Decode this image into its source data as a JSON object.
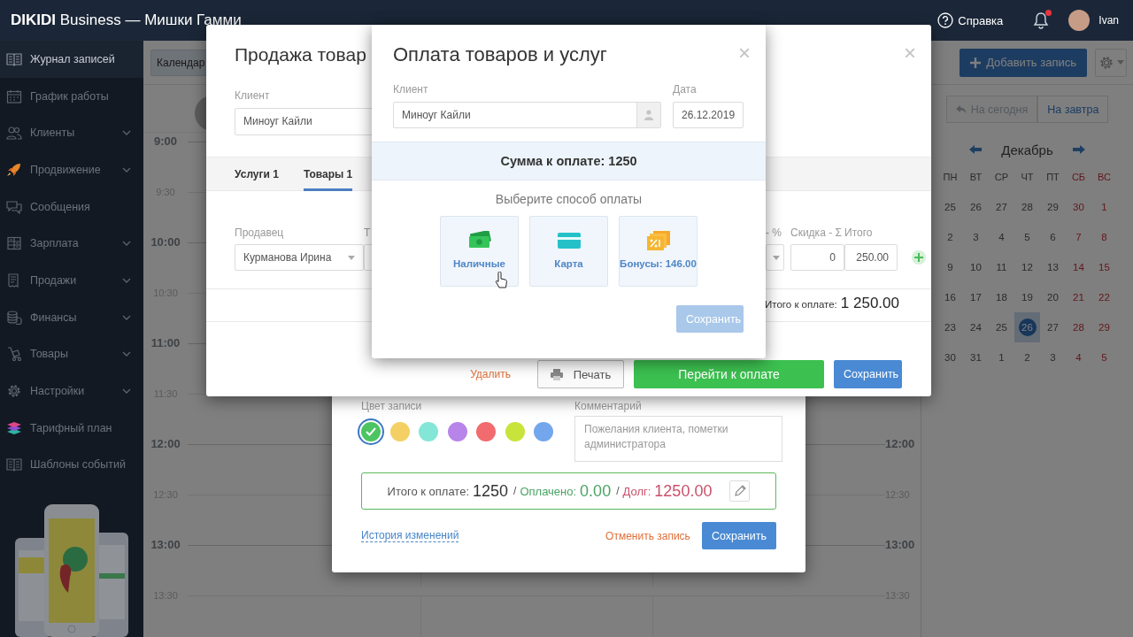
{
  "topbar": {
    "title": "**DIKIDI** Business — Мишки Гамми",
    "help": "Справка",
    "has_unread": true,
    "user": "Ivan"
  },
  "sidebar": {
    "items": [
      {
        "label": "Журнал записей",
        "selected": true,
        "expandable": false
      },
      {
        "label": "График работы",
        "selected": false,
        "expandable": false
      },
      {
        "label": "Клиенты",
        "selected": false,
        "expandable": true
      },
      {
        "label": "Продвижение",
        "selected": false,
        "expandable": true
      },
      {
        "label": "Сообщения",
        "selected": false,
        "expandable": false
      },
      {
        "label": "Зарплата",
        "selected": false,
        "expandable": true
      },
      {
        "label": "Продажи",
        "selected": false,
        "expandable": true
      },
      {
        "label": "Финансы",
        "selected": false,
        "expandable": true
      },
      {
        "label": "Товары",
        "selected": false,
        "expandable": true
      },
      {
        "label": "Настройки",
        "selected": false,
        "expandable": true
      },
      {
        "label": "Тарифный план",
        "selected": false,
        "expandable": false
      },
      {
        "label": "Шаблоны событий",
        "selected": false,
        "expandable": false
      }
    ]
  },
  "toolbar": {
    "tab": "Календар",
    "add_button": "Добавить запись"
  },
  "schedule": {
    "slots": [
      {
        "time": "9:00",
        "major": true
      },
      {
        "time": "9:30",
        "major": false
      },
      {
        "time": "10:00",
        "major": true
      },
      {
        "time": "10:30",
        "major": false
      },
      {
        "time": "11:00",
        "major": true
      },
      {
        "time": "11:30",
        "major": false
      },
      {
        "time": "12:00",
        "major": true,
        "time_right": "12:00"
      },
      {
        "time": "12:30",
        "major": false,
        "time_right": "12:30"
      },
      {
        "time": "13:00",
        "major": true,
        "time_right": "13:00"
      },
      {
        "time": "13:30",
        "major": false,
        "time_right": "13:30"
      }
    ]
  },
  "date_panel": {
    "buttons": [
      {
        "label": "На сегодня",
        "disabled": true
      },
      {
        "label": "На завтра",
        "disabled": false
      }
    ],
    "month": "Декабрь",
    "weekdays": [
      {
        "label": "ПН",
        "weekend": false
      },
      {
        "label": "ВТ",
        "weekend": false
      },
      {
        "label": "СР",
        "weekend": false
      },
      {
        "label": "ЧТ",
        "weekend": false
      },
      {
        "label": "ПТ",
        "weekend": false
      },
      {
        "label": "СБ",
        "weekend": true
      },
      {
        "label": "ВС",
        "weekend": true
      }
    ],
    "weeks": [
      [
        {
          "day": "25",
          "selected": false
        },
        {
          "day": "26",
          "selected": false
        },
        {
          "day": "27",
          "selected": false
        },
        {
          "day": "28",
          "selected": false
        },
        {
          "day": "29",
          "selected": false
        },
        {
          "day": "30",
          "selected": false
        },
        {
          "day": "1",
          "selected": false
        }
      ],
      [
        {
          "day": "2",
          "selected": false
        },
        {
          "day": "3",
          "selected": false
        },
        {
          "day": "4",
          "selected": false
        },
        {
          "day": "5",
          "selected": false
        },
        {
          "day": "6",
          "selected": false
        },
        {
          "day": "7",
          "selected": false
        },
        {
          "day": "8",
          "selected": false
        }
      ],
      [
        {
          "day": "9",
          "selected": false
        },
        {
          "day": "10",
          "selected": false
        },
        {
          "day": "11",
          "selected": false
        },
        {
          "day": "12",
          "selected": false
        },
        {
          "day": "13",
          "selected": false
        },
        {
          "day": "14",
          "selected": false
        },
        {
          "day": "15",
          "selected": false
        }
      ],
      [
        {
          "day": "16",
          "selected": false
        },
        {
          "day": "17",
          "selected": false
        },
        {
          "day": "18",
          "selected": false
        },
        {
          "day": "19",
          "selected": false
        },
        {
          "day": "20",
          "selected": false
        },
        {
          "day": "21",
          "selected": false
        },
        {
          "day": "22",
          "selected": false
        }
      ],
      [
        {
          "day": "23",
          "selected": false
        },
        {
          "day": "24",
          "selected": false
        },
        {
          "day": "25",
          "selected": false
        },
        {
          "day": "26",
          "selected": true
        },
        {
          "day": "27",
          "selected": false
        },
        {
          "day": "28",
          "selected": false
        },
        {
          "day": "29",
          "selected": false
        }
      ],
      [
        {
          "day": "30",
          "selected": false
        },
        {
          "day": "31",
          "selected": false
        },
        {
          "day": "1",
          "selected": false
        },
        {
          "day": "2",
          "selected": false
        },
        {
          "day": "3",
          "selected": false
        },
        {
          "day": "4",
          "selected": false
        },
        {
          "day": "5",
          "selected": false
        }
      ]
    ]
  },
  "appointment_dialog": {
    "color_label": "Цвет записи",
    "colors": [
      {
        "color": "#4cc462",
        "selected": true
      },
      {
        "color": "#f4cf63",
        "selected": false
      },
      {
        "color": "#84e6d6",
        "selected": false
      },
      {
        "color": "#b784ea",
        "selected": false
      },
      {
        "color": "#f26b6e",
        "selected": false
      },
      {
        "color": "#c8e43a",
        "selected": false
      },
      {
        "color": "#74a6ee",
        "selected": false
      }
    ],
    "comment_label": "Комментарий",
    "comment_placeholder": "Пожелания клиента, пометки администратора",
    "summary": [
      {
        "kind": "total",
        "label": "Итого к оплате:",
        "value": "1250"
      },
      {
        "kind": "separator",
        "text": "/"
      },
      {
        "kind": "paid",
        "label": "Оплачено:",
        "value": "0.00"
      },
      {
        "kind": "separator",
        "text": "/"
      },
      {
        "kind": "debt",
        "label": "Долг:",
        "value": "1250.00"
      }
    ],
    "history_link": "История изменений",
    "cancel": "Отменить запись",
    "save": "Сохранить"
  },
  "sale_dialog": {
    "title": "Продажа товар",
    "close": "×",
    "client_label": "Клиент",
    "client": "Миноуг Кайли",
    "tabs": [
      {
        "label": "Услуги 1",
        "selected": false
      },
      {
        "label": "Товары 1",
        "selected": true
      }
    ],
    "columns": [
      "Продавец",
      "Т",
      "- %",
      "Скидка - Σ",
      "Итого"
    ],
    "row": {
      "seller": "Курманова Ирина",
      "discount_sum": "0",
      "total": "250.00"
    },
    "total_label": "Итого к оплате:",
    "total": "1 250.00",
    "delete": "Удалить",
    "print": "Печать",
    "pay": "Перейти к оплате",
    "save": "Сохранить"
  },
  "payment_dialog": {
    "title": "Оплата товаров и услуг",
    "close": "×",
    "client_label": "Клиент",
    "client": "Миноуг Кайли",
    "date_label": "Дата",
    "date": "26.12.2019",
    "amount": "Сумма к оплате: 1250",
    "prompt": "Выберите способ оплаты",
    "methods": [
      {
        "kind": "cash",
        "label": "Наличные"
      },
      {
        "kind": "card",
        "label": "Карта"
      },
      {
        "kind": "bonus",
        "label": "Бонусы: 146.00"
      }
    ],
    "save": {
      "label": "Сохранить",
      "disabled": true
    }
  }
}
